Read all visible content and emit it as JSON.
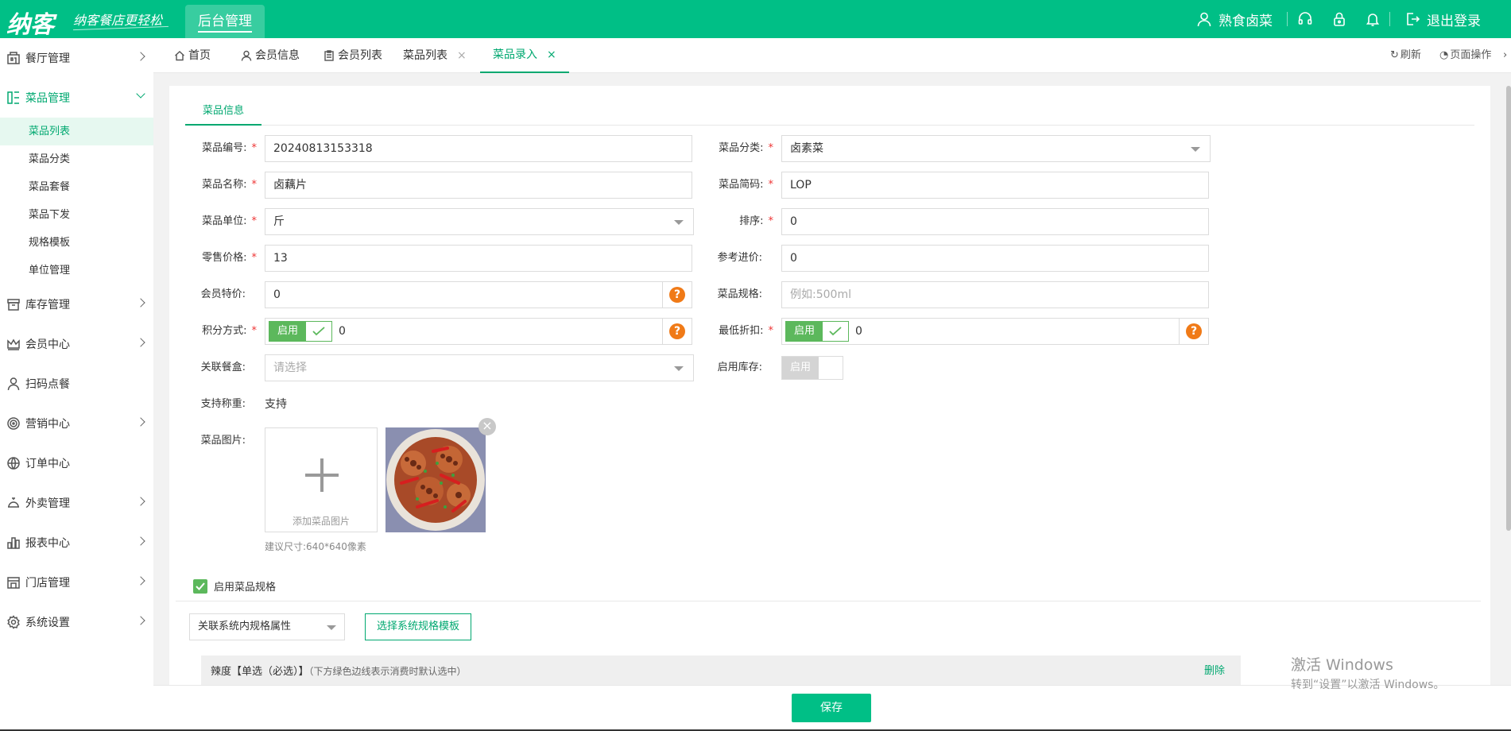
{
  "header": {
    "logo": "纳客",
    "slogan": "纳客餐店更轻松",
    "active_tab": "后台管理",
    "user_name": "熟食卤菜",
    "logout": "退出登录",
    "icons": [
      "user-icon",
      "headset-icon",
      "lock-icon",
      "bell-icon",
      "logout-icon"
    ]
  },
  "sidebar": {
    "items": [
      {
        "label": "餐厅管理",
        "icon": "restaurant-icon"
      },
      {
        "label": "菜品管理",
        "icon": "dish-icon",
        "open": true
      },
      {
        "label": "库存管理",
        "icon": "inventory-icon"
      },
      {
        "label": "会员中心",
        "icon": "crown-icon"
      },
      {
        "label": "扫码点餐",
        "icon": "person-icon"
      },
      {
        "label": "营销中心",
        "icon": "target-icon"
      },
      {
        "label": "订单中心",
        "icon": "globe-icon"
      },
      {
        "label": "外卖管理",
        "icon": "cloche-icon"
      },
      {
        "label": "报表中心",
        "icon": "chart-icon"
      },
      {
        "label": "门店管理",
        "icon": "store-icon"
      },
      {
        "label": "系统设置",
        "icon": "gear-icon"
      }
    ],
    "sub_items": [
      "菜品列表",
      "菜品分类",
      "菜品套餐",
      "菜品下发",
      "规格模板",
      "单位管理"
    ],
    "active_sub": "菜品列表"
  },
  "tabs": {
    "items": [
      "首页",
      "会员信息",
      "会员列表",
      "菜品列表",
      "菜品录入"
    ],
    "active": "菜品录入",
    "refresh": "刷新",
    "page_ops": "页面操作"
  },
  "form": {
    "section_tab": "菜品信息",
    "code_label": "菜品编号:",
    "code_value": "20240813153318",
    "category_label": "菜品分类:",
    "category_value": "卤素菜",
    "name_label": "菜品名称:",
    "name_value": "卤藕片",
    "short_code_label": "菜品简码:",
    "short_code_value": "LOP",
    "unit_label": "菜品单位:",
    "unit_value": "斤",
    "sort_label": "排序:",
    "sort_value": "0",
    "retail_label": "零售价格:",
    "retail_value": "13",
    "ref_price_label": "参考进价:",
    "ref_price_value": "0",
    "member_label": "会员特价:",
    "member_value": "0",
    "spec_label": "菜品规格:",
    "spec_placeholder": "例如:500ml",
    "points_label": "积分方式:",
    "points_toggle": "启用",
    "points_value": "0",
    "discount_label": "最低折扣:",
    "discount_toggle": "启用",
    "discount_value": "0",
    "box_label": "关联餐盒:",
    "box_placeholder": "请选择",
    "stock_label": "启用库存:",
    "stock_toggle": "启用",
    "weigh_label": "支持称重:",
    "weigh_value": "支持",
    "image_label": "菜品图片:",
    "add_image": "添加菜品图片",
    "size_hint": "建议尺寸:640*640像素",
    "help": "?",
    "close": "×"
  },
  "specs": {
    "enable_label": "启用菜品规格",
    "attr_select": "关联系统内规格属性",
    "template_button": "选择系统规格模板",
    "row_title": "辣度【单选（必选）】",
    "row_note": "（下方绿色边线表示消费时默认选中）",
    "delete": "删除"
  },
  "footer": {
    "save": "保存"
  },
  "watermark": {
    "line1": "激活 Windows",
    "line2": "转到“设置”以激活 Windows。"
  },
  "colors": {
    "brand": "#00bf86",
    "accent": "#00a870",
    "toggle": "#5cb85c",
    "help": "#f07a17",
    "required": "#ee3333"
  }
}
